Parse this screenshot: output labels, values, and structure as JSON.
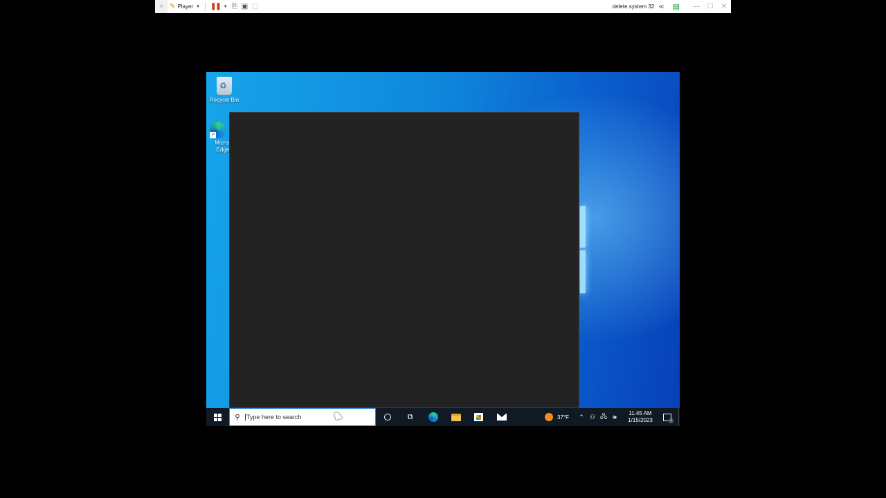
{
  "vm_toolbar": {
    "player_label": "Player",
    "vm_name": "delete system 32",
    "collapse_glyph": "≪"
  },
  "desktop": {
    "icons": [
      {
        "label": "Recycle Bin",
        "icon": "recycle-bin-icon"
      },
      {
        "label": "Micros Edge",
        "icon": "edge-icon"
      }
    ]
  },
  "taskbar": {
    "search_placeholder": "Type here to search",
    "weather_temp": "37°F",
    "time": "11:45 AM",
    "date": "1/15/2023",
    "notification_count": "1"
  }
}
